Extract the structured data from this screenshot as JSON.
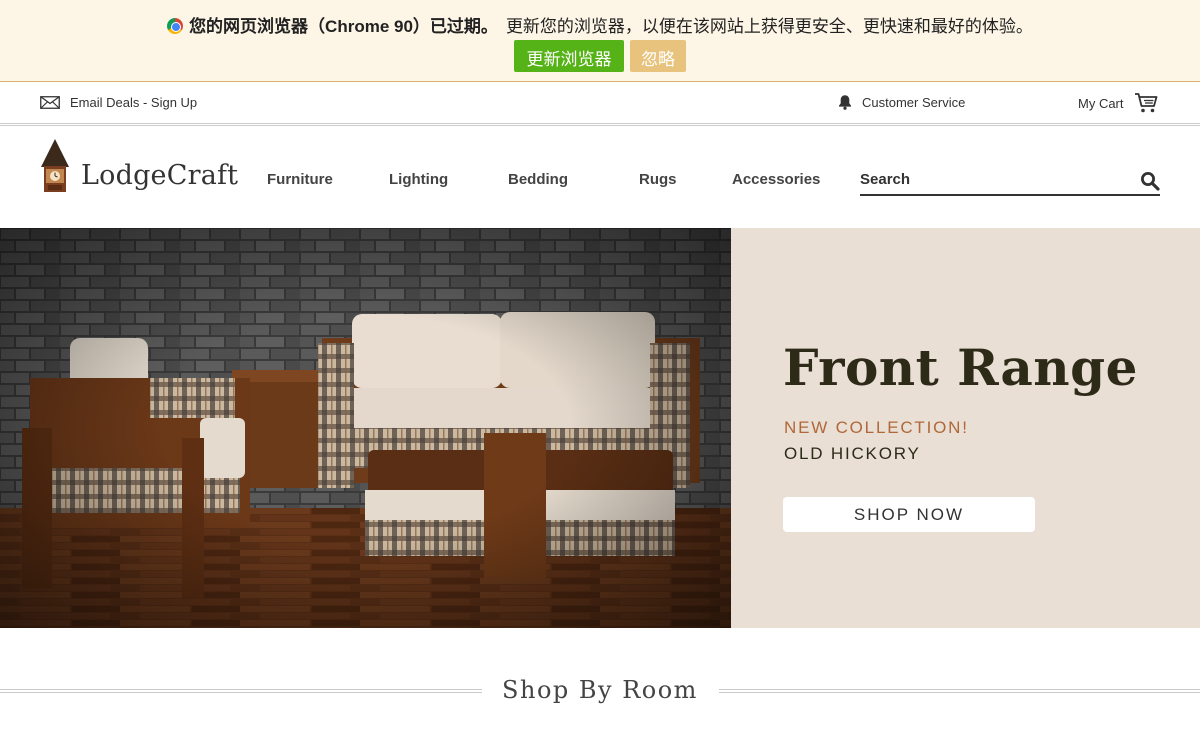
{
  "update_banner": {
    "icon": "chrome-icon",
    "headline": "您的网页浏览器（Chrome 90）已过期。",
    "message": "更新您的浏览器，以便在该网站上获得更安全、更快速和最好的体验。",
    "update_label": "更新浏览器",
    "ignore_label": "忽略",
    "colors": {
      "background": "#fdf5e6",
      "update_button": "#56b317",
      "ignore_button": "#e8c37d"
    }
  },
  "utility_bar": {
    "email_deals": "Email Deals - Sign Up",
    "customer_service": "Customer Service",
    "my_cart": "My Cart"
  },
  "header": {
    "logo_text": "LodgeCraft",
    "nav": [
      "Furniture",
      "Lighting",
      "Bedding",
      "Rugs",
      "Accessories"
    ],
    "search_placeholder": "Search"
  },
  "hero": {
    "title": "Front Range",
    "kicker": "NEW COLLECTION!",
    "subtitle": "OLD HICKORY",
    "cta": "SHOP NOW",
    "colors": {
      "panel": "#e9dfd5",
      "title": "#2e2a18",
      "kicker": "#b0683a"
    }
  },
  "shop_by_room": {
    "title": "Shop By Room"
  }
}
